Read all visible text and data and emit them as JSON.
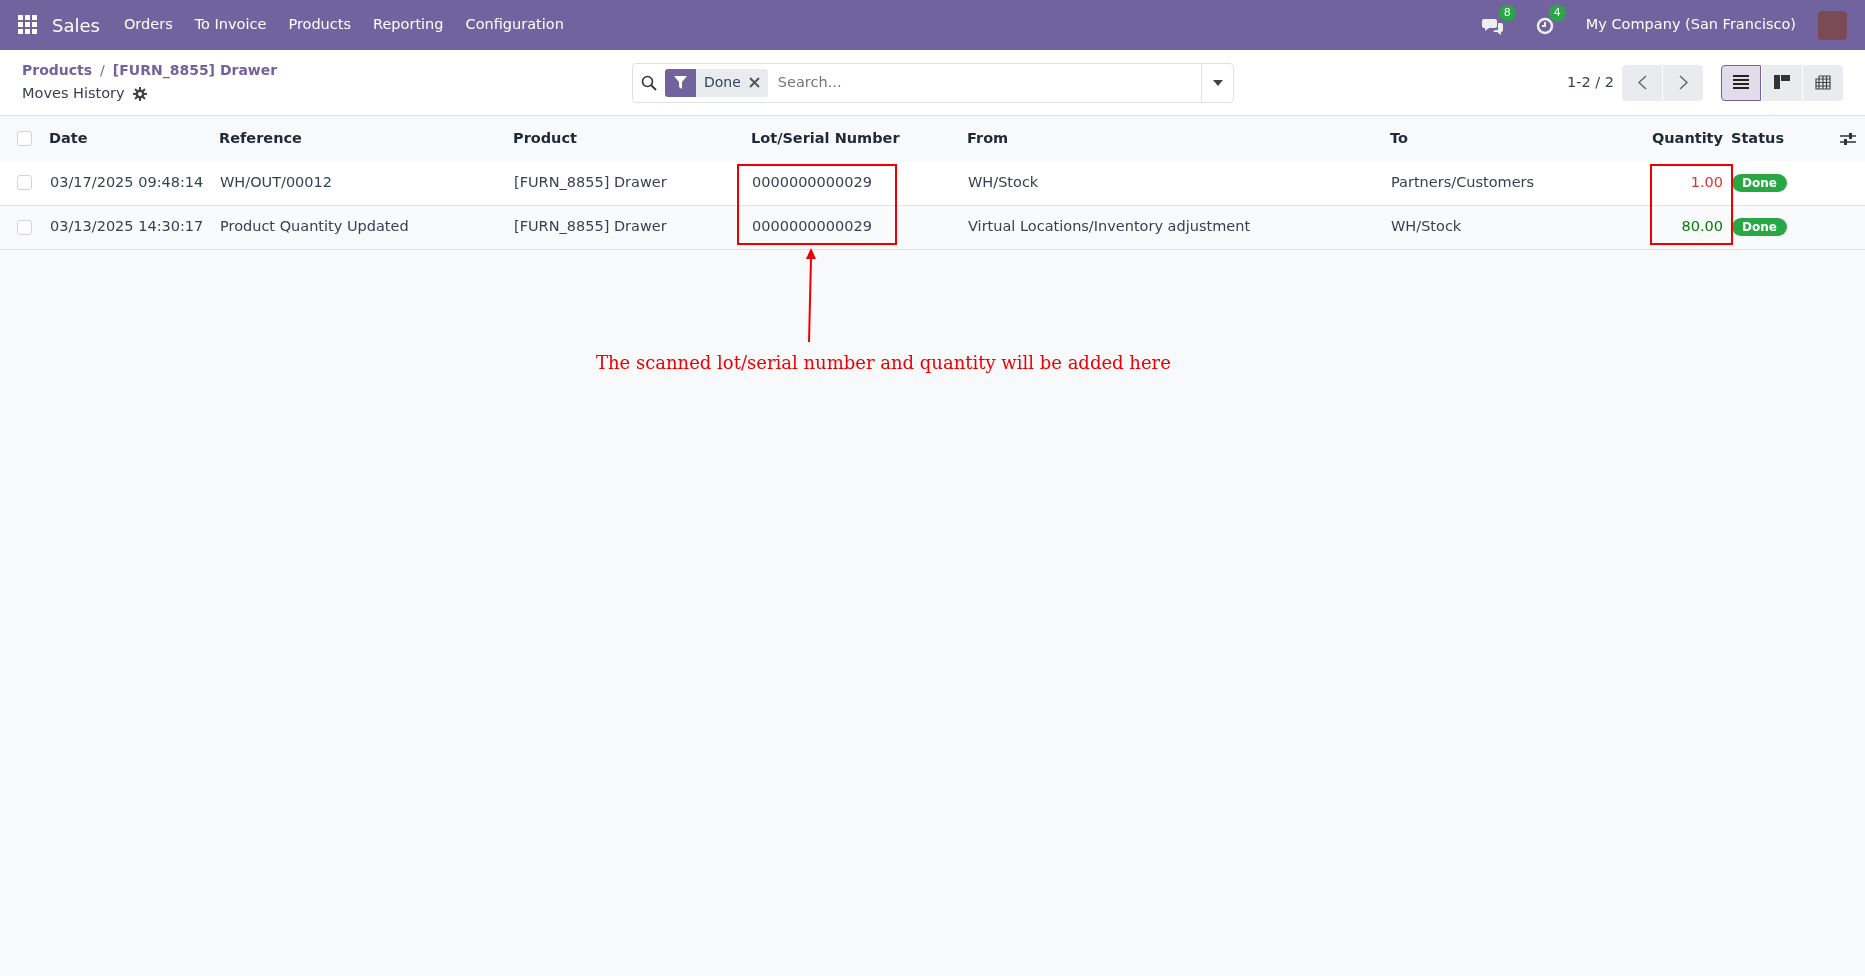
{
  "navbar": {
    "app": "Sales",
    "menu": [
      "Orders",
      "To Invoice",
      "Products",
      "Reporting",
      "Configuration"
    ],
    "messages_count": "8",
    "activities_count": "4",
    "company": "My Company (San Francisco)"
  },
  "breadcrumbs": [
    {
      "label": "Products"
    },
    {
      "label": "[FURN_8855] Drawer"
    }
  ],
  "breadcrumb_separator": "/",
  "page_title": "Moves History",
  "search": {
    "facet": "Done",
    "placeholder": "Search..."
  },
  "pager": "1-2 / 2",
  "views": [
    {
      "kind": "list",
      "selected": true
    },
    {
      "kind": "kanban",
      "selected": false
    },
    {
      "kind": "pivot",
      "selected": false
    }
  ],
  "table": {
    "select_all_checked": false,
    "columns": [
      "Date",
      "Reference",
      "Product",
      "Lot/Serial Number",
      "From",
      "To",
      "Quantity",
      "Status"
    ],
    "rows": [
      {
        "checked": false,
        "date": "03/17/2025 09:48:14",
        "reference": "WH/OUT/00012",
        "product": "[FURN_8855] Drawer",
        "lot": "0000000000029",
        "from": "WH/Stock",
        "to": "Partners/Customers",
        "quantity": "1.00",
        "color": "#e03131",
        "status": "Done"
      },
      {
        "checked": false,
        "date": "03/13/2025 14:30:17",
        "reference": "Product Quantity Updated",
        "product": "[FURN_8855] Drawer",
        "lot": "0000000000029",
        "from": "Virtual Locations/Inventory adjustment",
        "to": "WH/Stock",
        "quantity": "80.00",
        "color": "#008000",
        "status": "Done"
      }
    ]
  },
  "annotation": {
    "text": "The scanned lot/serial number and quantity will be added here"
  }
}
